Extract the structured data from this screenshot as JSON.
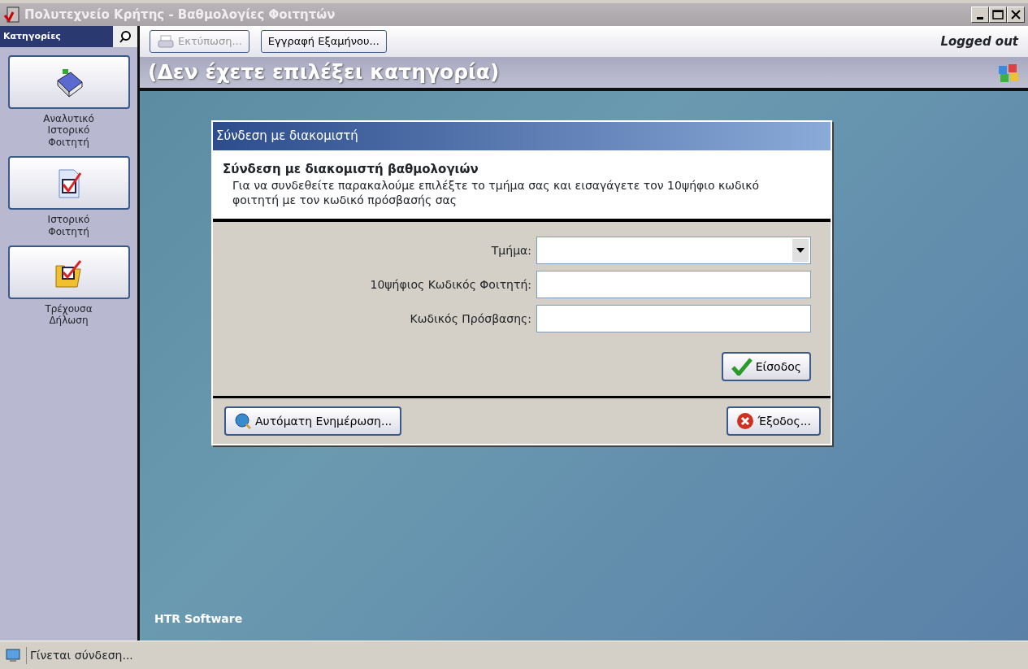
{
  "window": {
    "title": "Πολυτεχνείο Κρήτης - Βαθμολογίες Φοιτητών"
  },
  "sidebar": {
    "header": "Κατηγορίες",
    "items": [
      {
        "label": "Αναλυτικό Ιστορικό Φοιτητή",
        "kind": "book"
      },
      {
        "label": "Ιστορικό Φοιτητή",
        "kind": "document"
      },
      {
        "label": "Τρέχουσα Δήλωση",
        "kind": "folder"
      }
    ]
  },
  "toolbar": {
    "buttons": [
      {
        "label": "Εκτύπωση...",
        "disabled": true,
        "kind": "print"
      },
      {
        "label": "Εγγραφή Εξαμήνου...",
        "disabled": false,
        "kind": "plain"
      }
    ],
    "status": "Logged out"
  },
  "banner": {
    "title": "(Δεν έχετε επιλέξει κατηγορία)"
  },
  "dialog": {
    "title": "Σύνδεση με διακομιστή",
    "heading": "Σύνδεση με διακομιστή βαθμολογιών",
    "description": "Για να συνδεθείτε παρακαλούμε επιλέξτε το τμήμα σας και εισαγάγετε τον 10ψήφιο κωδικό φοιτητή με τον κωδικό πρόσβασής σας",
    "fields": [
      {
        "label": "Τμήμα:",
        "kind": "select"
      },
      {
        "label": "10ψήφιος Κωδικός Φοιτητή:",
        "kind": "text"
      },
      {
        "label": "Κωδικός Πρόσβασης:",
        "kind": "password"
      }
    ],
    "login_button": "Είσοδος",
    "footer_buttons": [
      {
        "label": "Αυτόματη Ενημέρωση...",
        "kind": "update"
      },
      {
        "label": "Έξοδος...",
        "kind": "exit"
      }
    ]
  },
  "branding": "HTR Software",
  "status_bar": {
    "text": "Γίνεται σύνδεση..."
  }
}
